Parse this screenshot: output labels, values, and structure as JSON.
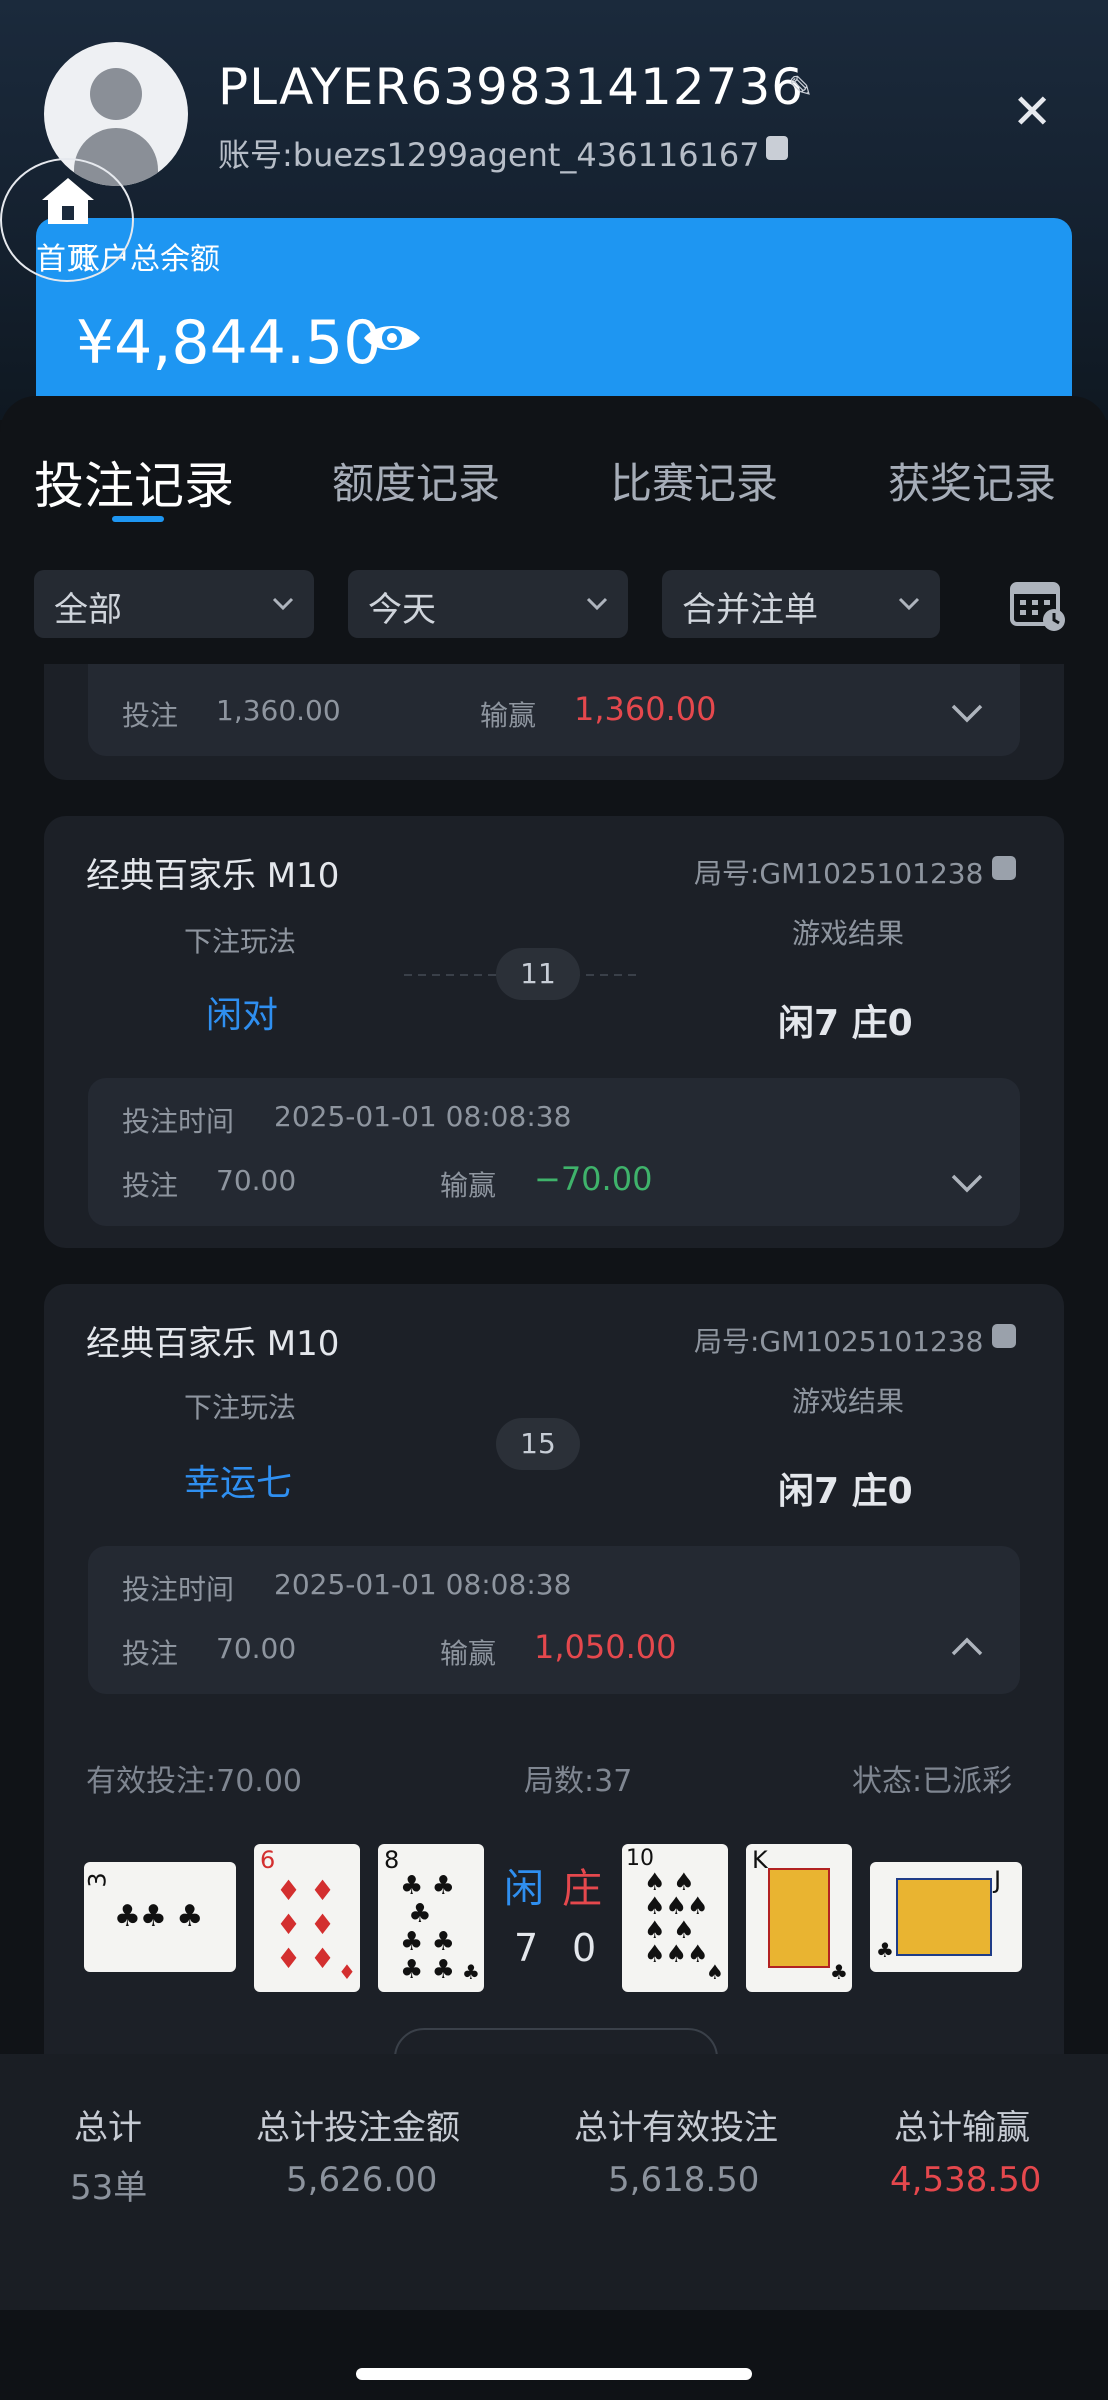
{
  "header": {
    "player_name": "PLAYER639831412736",
    "account": "账号:buezs1299agent_436116167",
    "home_label": "首页"
  },
  "balance": {
    "label": "账户总余额",
    "amount": "¥4,844.50"
  },
  "tabs": [
    {
      "label": "投注记录",
      "active": true
    },
    {
      "label": "额度记录",
      "active": false
    },
    {
      "label": "比赛记录",
      "active": false
    },
    {
      "label": "获奖记录",
      "active": false
    }
  ],
  "filters": {
    "type": "全部",
    "date": "今天",
    "merge": "合并注单"
  },
  "prev_record": {
    "bet_label": "投注",
    "bet_value": "1,360.00",
    "winloss_label": "输赢",
    "winloss_value": "1,360.00"
  },
  "records": [
    {
      "game": "经典百家乐 M10",
      "round_id": "局号:GM1025101238",
      "bet_type_label": "下注玩法",
      "bet_type": "闲对",
      "counter": "11",
      "result_label": "游戏结果",
      "result": "闲7 庄0",
      "time_label": "投注时间",
      "time": "2025-01-01 08:08:38",
      "bet_label": "投注",
      "bet_value": "70.00",
      "winloss_label": "输赢",
      "winloss_value": "−70.00"
    },
    {
      "game": "经典百家乐 M10",
      "round_id": "局号:GM1025101238",
      "bet_type_label": "下注玩法",
      "bet_type": "幸运七",
      "counter": "15",
      "result_label": "游戏结果",
      "result": "闲7 庄0",
      "time_label": "投注时间",
      "time": "2025-01-01 08:08:38",
      "bet_label": "投注",
      "bet_value": "70.00",
      "winloss_label": "输赢",
      "winloss_value": "1,050.00",
      "valid_bet": "有效投注:70.00",
      "rounds": "局数:37",
      "status": "状态:已派彩",
      "player_label": "闲",
      "banker_label": "庄",
      "player_score": "7",
      "banker_score": "0",
      "player_cards": [
        {
          "rank": "3",
          "suit": "♣"
        },
        {
          "rank": "6",
          "suit": "♦"
        },
        {
          "rank": "8",
          "suit": "♣"
        }
      ],
      "banker_cards": [
        {
          "rank": "10",
          "suit": "♠"
        },
        {
          "rank": "K",
          "suit": "♣"
        },
        {
          "rank": "J",
          "suit": "♣"
        }
      ]
    }
  ],
  "summary": {
    "total_label": "总计",
    "total_value": "53单",
    "bet_amount_label": "总计投注金额",
    "bet_amount_value": "5,626.00",
    "valid_bet_label": "总计有效投注",
    "valid_bet_value": "5,618.50",
    "winloss_label": "总计输赢",
    "winloss_value": "4,538.50"
  },
  "colors": {
    "accent": "#1e96f2",
    "win": "#e5484d",
    "loss": "#3fb36b",
    "player_blue": "#2f8ff0",
    "banker_red": "#e5484d"
  }
}
